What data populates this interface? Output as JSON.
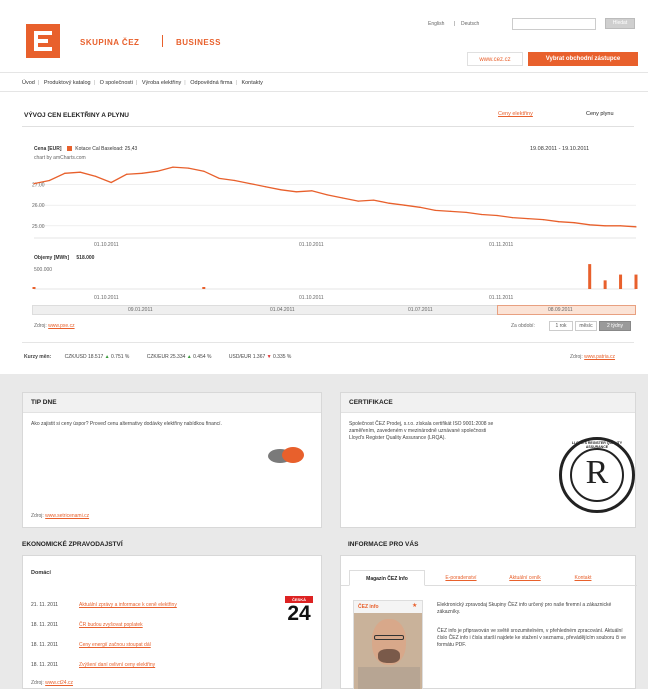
{
  "header": {
    "brand": "SKUPINA ČEZ",
    "section": "BUSINESS",
    "lang_links": [
      "English",
      "Deutsch"
    ],
    "search_button": "Hledat",
    "home_link": "www.cez.cz",
    "cta_button": "Vybrat obchodní zástupce"
  },
  "nav": [
    "Úvod",
    "Produktový katalog",
    "O společnosti",
    "Výroba elektřiny",
    "Odpovědná firma",
    "Kontakty"
  ],
  "prices": {
    "title": "VÝVOJ CEN ELEKTŘINY A PLYNU",
    "tabs": [
      "Ceny elektřiny",
      "Ceny plynu"
    ],
    "price_label": "Cena [EUR]",
    "series_label": "Kotace Cal Baseload: 25,43",
    "source_line": "chart by amCharts.com",
    "date_range": "19.08.2011 - 19.10.2011",
    "volume_label": "Objemy [MWh]",
    "volume_value": "518.000",
    "volume_tick": "500.000",
    "scroll_labels": [
      "09.01.2011",
      "01.04.2011",
      "01.07.2011",
      "08.09.2011"
    ],
    "source_note_prefix": "Zdroj:",
    "source_note_link": "www.pxe.cz",
    "zoom_label": "Za období:",
    "zoom_buttons": [
      "1 rok",
      "měsíc",
      "2 týdny"
    ],
    "fx_label": "Kurzy měn:",
    "fx": [
      {
        "text": "CZK/USD 18.517",
        "dir": "up",
        "change": "0.751 %"
      },
      {
        "text": "CZK/EUR 25.334",
        "dir": "up",
        "change": "0.454 %"
      },
      {
        "text": "USD/EUR 1.367",
        "dir": "down",
        "change": "0.335 %"
      }
    ],
    "fx_source_prefix": "Zdroj:",
    "fx_source_link": "www.patria.cz"
  },
  "chart_data": {
    "type": "line",
    "title": "",
    "ylabel": "Cena [EUR]",
    "x_ticks": [
      "01.10.2011",
      "01.10.2011",
      "01.11.2011"
    ],
    "y_ticks": [
      "27.00",
      "26.00",
      "25.00"
    ],
    "ylim": [
      24.7,
      28.0
    ],
    "series": [
      {
        "name": "Kotace Cal Baseload",
        "values": [
          27.05,
          27.2,
          27.55,
          27.6,
          27.4,
          27.1,
          27.5,
          27.55,
          27.65,
          27.85,
          27.8,
          27.65,
          27.3,
          27.2,
          27.05,
          26.9,
          26.75,
          26.65,
          26.7,
          26.5,
          26.35,
          26.2,
          26.25,
          26.1,
          26.0,
          25.9,
          25.75,
          25.7,
          25.65,
          25.55,
          25.5,
          25.4,
          25.35,
          25.3,
          25.2,
          25.15,
          25.05,
          25.0,
          25.0,
          24.95
        ]
      }
    ],
    "volume": {
      "name": "Objemy [MWh]",
      "ylim": [
        0,
        520000
      ],
      "values": [
        40000,
        0,
        0,
        0,
        0,
        0,
        0,
        0,
        0,
        0,
        0,
        30000,
        0,
        0,
        0,
        0,
        0,
        0,
        0,
        0,
        0,
        0,
        0,
        0,
        0,
        0,
        0,
        0,
        0,
        0,
        0,
        0,
        0,
        0,
        0,
        0,
        518000,
        180000,
        300000,
        300000
      ]
    }
  },
  "tip": {
    "title": "TIP DNE",
    "text": "Ako zajistit si ceny úspor? Proveď cenu alternativy dodávky elektřiny nabídkou financí.",
    "source_prefix": "Zdroj:",
    "source_link": "www.setricenami.cz"
  },
  "cert": {
    "title": "CERTIFIKACE",
    "text": "Společnost ČEZ Prodej, s.r.o. získala certifikát ISO 9001:2008 se zaměřením, zavedeném v mezinárodně uznávané společnosti Lloyd's Register Quality Assurance (LRQA).",
    "seal_ring": "LLOYD'S REGISTER QUALITY ASSURANCE",
    "seal_letter": "R"
  },
  "econ": {
    "title": "EKONOMICKÉ ZPRAVODAJSTVÍ",
    "subtitle": "Domácí",
    "logo_top": "ČESKÁ",
    "logo_num": "24",
    "rows": [
      {
        "date": "21. 11. 2011",
        "text": "Aktuální zprávy a informace k ceně elektřiny"
      },
      {
        "date": "18. 11. 2011",
        "text": "ČR budou zvyšovat poplatek"
      },
      {
        "date": "18. 11. 2011",
        "text": "Ceny energií začnou stoupat dál"
      },
      {
        "date": "18. 11. 2011",
        "text": "Zvýšení daní ovlivní ceny elektřiny"
      }
    ],
    "source_prefix": "Zdroj:",
    "source_link": "www.ct24.cz"
  },
  "info": {
    "title": "INFORMACE PRO VÁS",
    "tabs": [
      "Magazín ČEZ Info",
      "E-poradenství",
      "Aktuální ceník",
      "Kontakt"
    ],
    "mag_name": "ČEZ info",
    "text1": "Elektronický zpravodaj Skupiny ČEZ info určený pro naše firemní a zákaznické zákazníky.",
    "text2": "ČEZ info je připravován ve světě srozumitelném, v přehledném zpracování. Aktuální číslo ČEZ info i čísla starší najdete ke stažení v seznamu, převádějícím souboru či ve formátu PDF."
  },
  "colors": {
    "accent": "#e8602c",
    "grid": "#dddddd",
    "panel_header": "#f1f1f1"
  }
}
